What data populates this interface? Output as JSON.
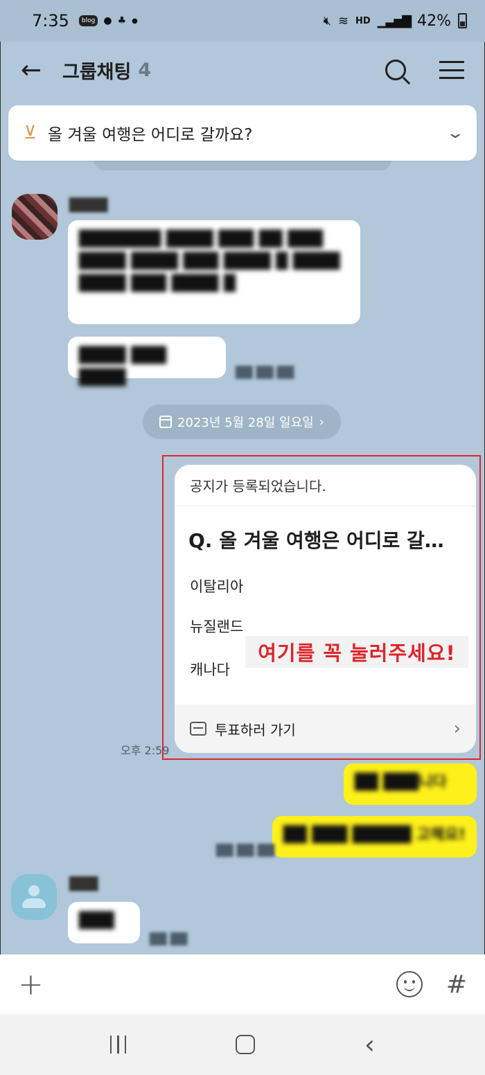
{
  "status_bar": {
    "time": "7:35",
    "blog_badge": "blog",
    "battery_percent": "42%",
    "network": "HD"
  },
  "header": {
    "title": "그룹채팅",
    "member_count": "4"
  },
  "notice_banner": {
    "text": "올 겨울 여행은 어디로 갈까요?"
  },
  "messages_top": {
    "sender_name": "████",
    "bubble1": "███████ ████ ███ ██ ███ ████ ████ ███ ████ █ ████ ████ ███ ████ █",
    "bubble2": "████ ███ ████",
    "time1": "██ ██:██"
  },
  "date_divider": {
    "label": "2023년 5월 28일 일요일",
    "chevron": "›"
  },
  "poll_card": {
    "header": "공지가 등록되었습니다.",
    "question": "Q. 올 겨울 여행은 어디로 갈…",
    "options": [
      "이탈리아",
      "뉴질랜드",
      "캐나다"
    ],
    "footer_label": "투표하러 가기",
    "time": "오후 2:59"
  },
  "annotation": {
    "text": "여기를 꼭 눌러주세요!",
    "color": "#e0242a"
  },
  "my_messages": {
    "bubble1": "██ ███니다",
    "bubble2": "██ ███ █████ 고해요!",
    "time": "██ ██:██"
  },
  "messages_bottom": {
    "sender_name": "███",
    "bubble": "███",
    "time": "██ ██"
  },
  "input_bar": {
    "plus": "+",
    "hash": "#"
  },
  "colors": {
    "background": "#b2c7d9",
    "my_bubble": "#fef01b",
    "highlight": "#e0242a"
  }
}
